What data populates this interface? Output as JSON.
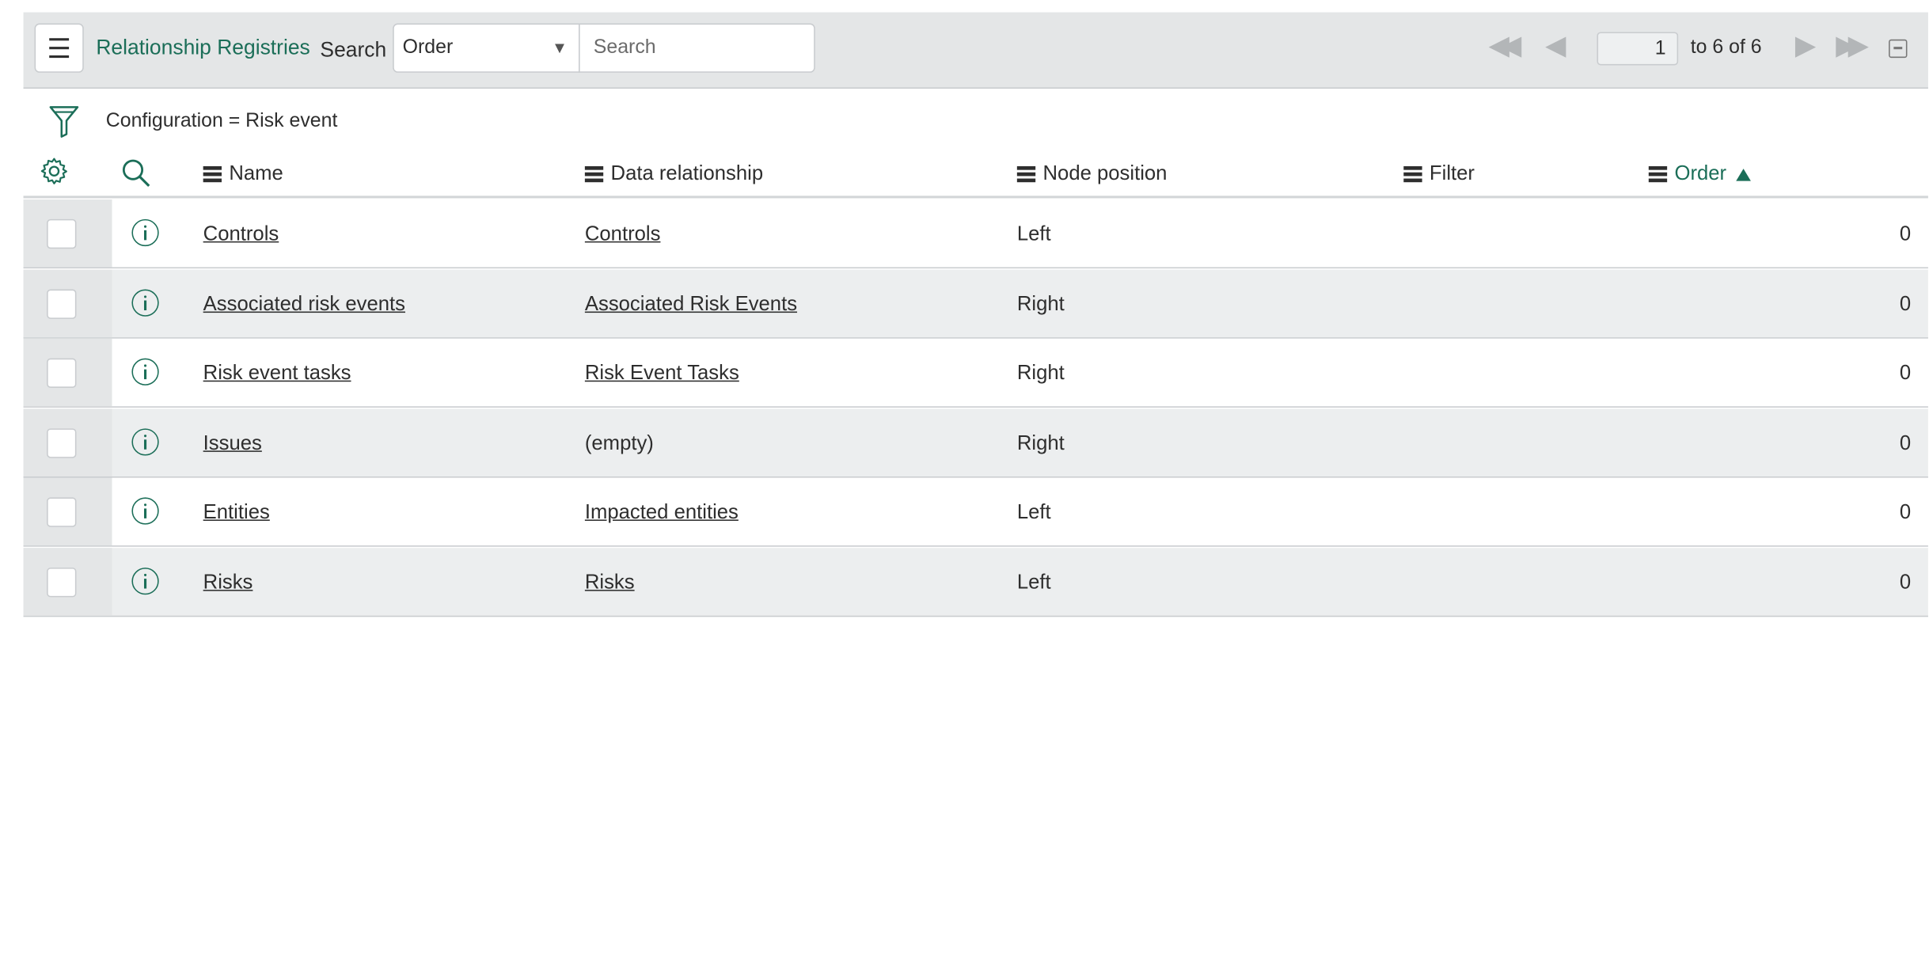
{
  "header": {
    "menu_icon": "hamburger-menu-icon",
    "title": "Relationship Registries",
    "search_label": "Search",
    "search_field_select": "Order",
    "search_placeholder": "Search",
    "pager": {
      "current_page": "1",
      "range_text": "to 6 of 6"
    }
  },
  "filter": {
    "breadcrumb": "Configuration = Risk event"
  },
  "table": {
    "columns": [
      "Name",
      "Data relationship",
      "Node position",
      "Filter",
      "Order"
    ],
    "sorted_column": "Order",
    "sort_direction": "ascending",
    "rows": [
      {
        "name": "Controls",
        "data_relationship": "Controls",
        "node_position": "Left",
        "filter": "",
        "order": "0"
      },
      {
        "name": "Associated risk events",
        "data_relationship": "Associated Risk Events",
        "node_position": "Right",
        "filter": "",
        "order": "0"
      },
      {
        "name": "Risk event tasks",
        "data_relationship": "Risk Event Tasks",
        "node_position": "Right",
        "filter": "",
        "order": "0"
      },
      {
        "name": "Issues",
        "data_relationship": "(empty)",
        "node_position": "Right",
        "filter": "",
        "order": "0"
      },
      {
        "name": "Entities",
        "data_relationship": "Impacted entities",
        "node_position": "Left",
        "filter": "",
        "order": "0"
      },
      {
        "name": "Risks",
        "data_relationship": "Risks",
        "node_position": "Left",
        "filter": "",
        "order": "0"
      }
    ]
  },
  "colors": {
    "accent": "#1b6e58",
    "header_bg": "#e4e6e7",
    "row_alt_bg": "#eceeef"
  }
}
